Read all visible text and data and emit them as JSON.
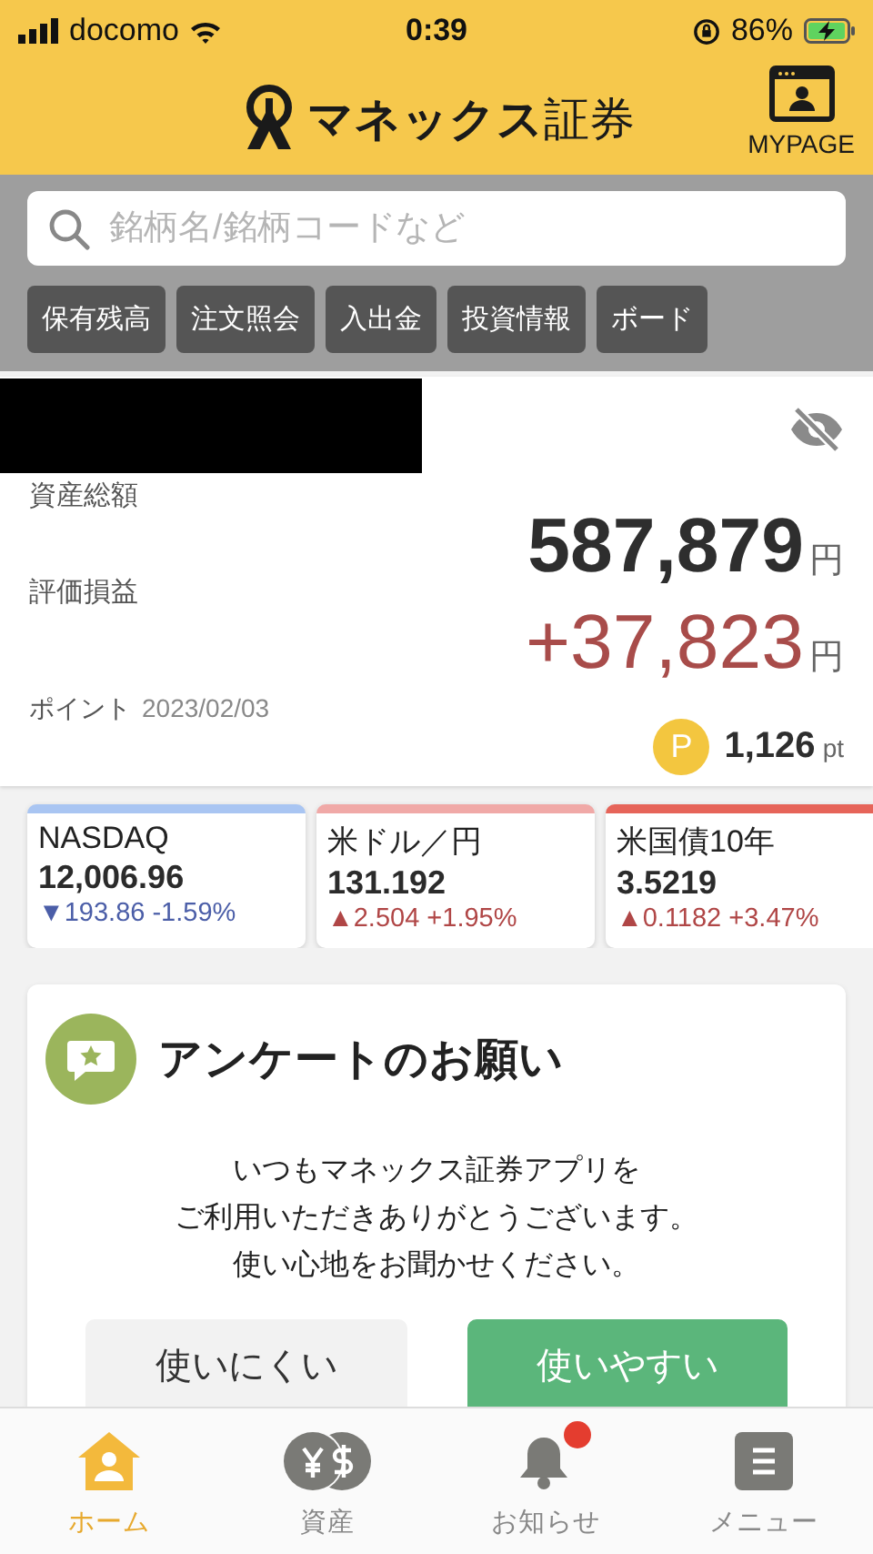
{
  "status_bar": {
    "carrier": "docomo",
    "time": "0:39",
    "battery": "86%"
  },
  "header": {
    "logo_text": "**マネックス**証券",
    "mypage_label": "MYPAGE"
  },
  "search": {
    "placeholder": "銘柄名/銘柄コードなど"
  },
  "quick_links": [
    "保有残高",
    "注文照会",
    "入出金",
    "投資情報",
    "ボード"
  ],
  "portfolio": {
    "total_label": "資産総額",
    "total_value": "587,879",
    "total_unit": "円",
    "pl_label": "評価損益",
    "pl_value": "+37,823",
    "pl_unit": "円",
    "points_label": "ポイント",
    "points_date": "2023/02/03",
    "points_badge": "P",
    "points_value": "1,126",
    "points_unit": "pt"
  },
  "markets": [
    {
      "name": "NASDAQ",
      "value": "12,006.96",
      "change": "▼193.86 -1.59%",
      "kind": "down",
      "color": "#a9c5f2"
    },
    {
      "name": "米ドル／円",
      "value": "131.192",
      "change": "▲2.504 +1.95%",
      "kind": "up",
      "color": "#f0a9a7"
    },
    {
      "name": "米国債10年",
      "value": "3.5219",
      "change": "▲0.1182 +3.47%",
      "kind": "up",
      "color": "#e66459"
    }
  ],
  "survey": {
    "title": "アンケートのお願い",
    "message_lines": [
      "いつもマネックス証券アプリを",
      "ご利用いただきありがとうございます。",
      "使い心地をお聞かせください。"
    ],
    "buttons": [
      {
        "label": "使いにくい",
        "kind": "neutral"
      },
      {
        "label": "使いやすい",
        "kind": "primary"
      }
    ]
  },
  "tab_bar": [
    {
      "label": "ホーム",
      "kind": "home",
      "selected": true,
      "badge": false
    },
    {
      "label": "資産",
      "kind": "assets",
      "selected": false,
      "badge": false
    },
    {
      "label": "お知らせ",
      "kind": "notice",
      "selected": false,
      "badge": true
    },
    {
      "label": "メニュー",
      "kind": "menu",
      "selected": false,
      "badge": false
    }
  ]
}
